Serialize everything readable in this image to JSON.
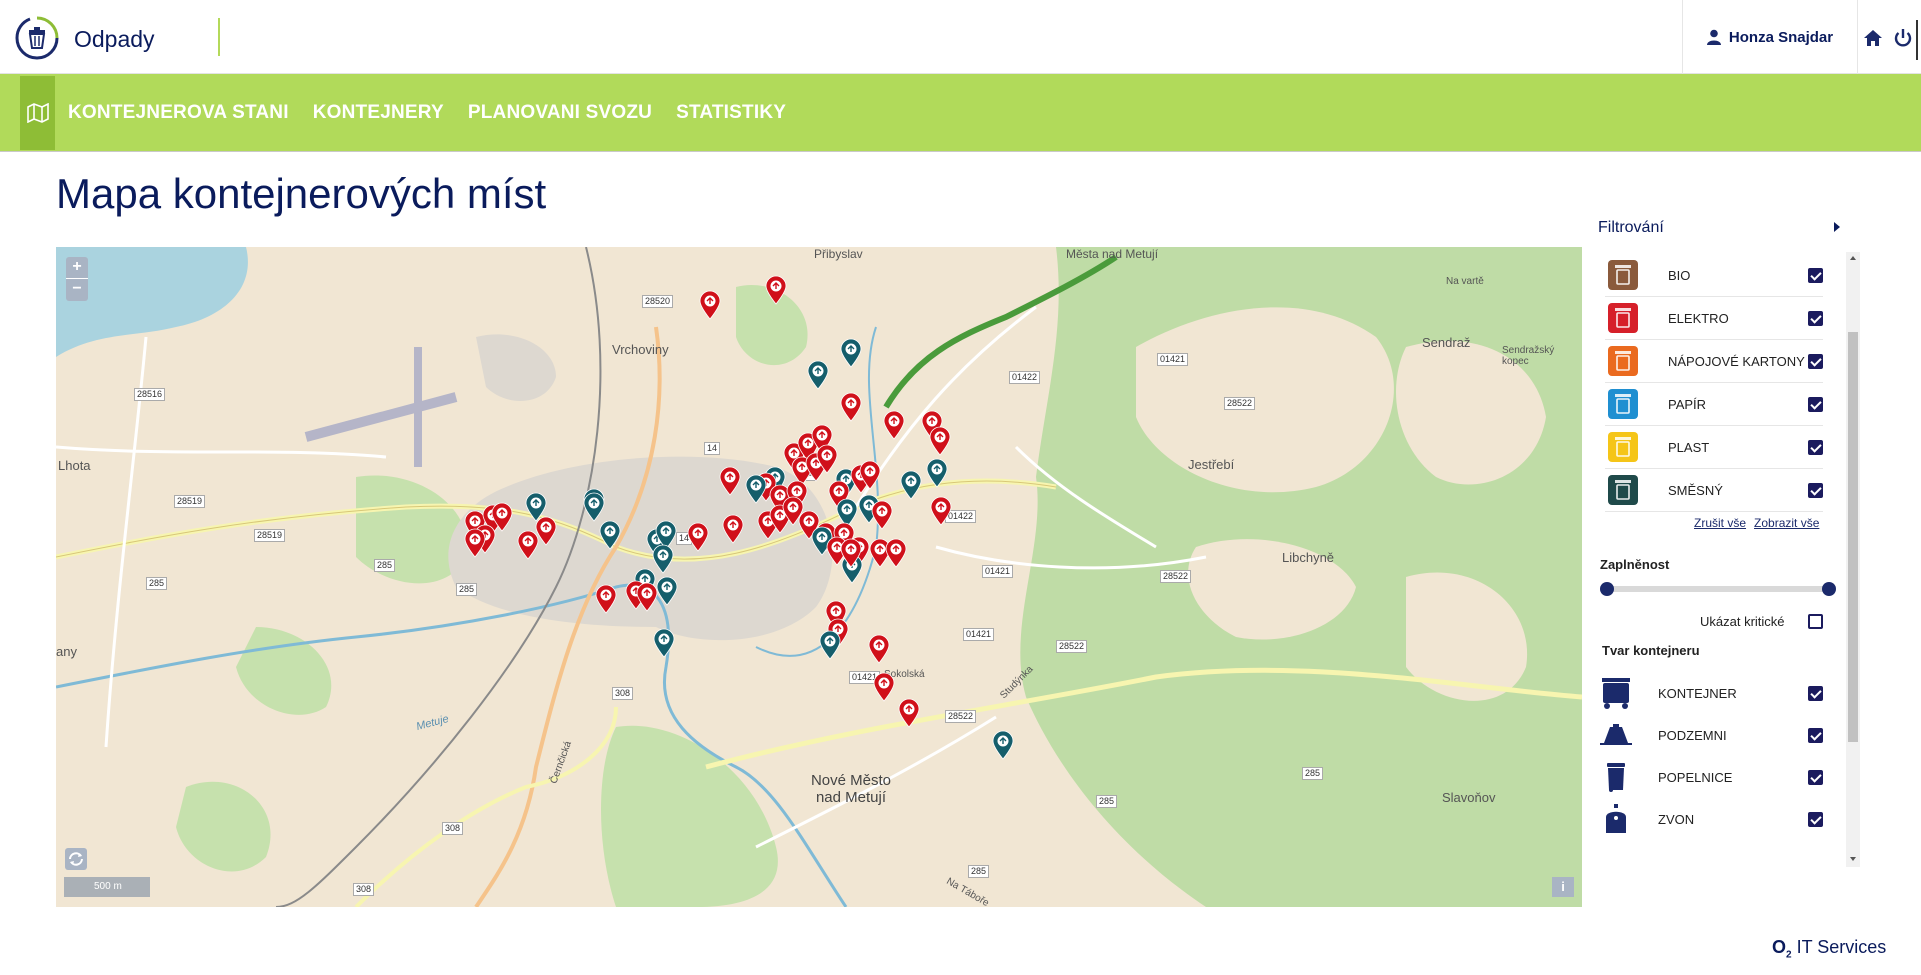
{
  "header": {
    "app_name": "Odpady",
    "user_name": "Honza Snajdar"
  },
  "nav": {
    "items": [
      {
        "label": "KONTEJNEROVA STANI"
      },
      {
        "label": "KONTEJNERY"
      },
      {
        "label": "PLANOVANI SVOZU"
      },
      {
        "label": "STATISTIKY"
      }
    ]
  },
  "page": {
    "title": "Mapa kontejnerových míst"
  },
  "map": {
    "zoom_in": "+",
    "zoom_out": "−",
    "scale_label": "500 m",
    "info_label": "i",
    "place_labels": {
      "vrchoviny": "Vrchoviny",
      "pribyslav": "Přibyslav",
      "mesta_nad_metuji": "Města nad Metují",
      "na_varte": "Na vartě",
      "sendraz": "Sendraž",
      "sendrazsky_kopec": "Sendražský kopec",
      "lhota": "Lhota",
      "jestrebi": "Jestřebí",
      "libchyne": "Libchyně",
      "nove_mesto": "Nové Město nad Metují",
      "slavonov": "Slavoňov",
      "any": "any",
      "na_tabore": "Na Táboře",
      "studynka": "Studýnka",
      "sokolska": "Sokolská",
      "metuje": "Metuje",
      "cernovska": "Černčická"
    },
    "road_numbers": {
      "r28520": "28520",
      "r28516": "28516",
      "r28519a": "28519",
      "r28519b": "28519",
      "r285a": "285",
      "r285b": "285",
      "r285c": "285",
      "r285d": "285",
      "r285e": "285",
      "r285f": "285",
      "r14a": "14",
      "r14b": "14",
      "r14c": "14",
      "r01422a": "01422",
      "r01422b": "01422",
      "r01421a": "01421",
      "r01421b": "01421",
      "r01421c": "01421",
      "r01421d": "01421",
      "r28522a": "28522",
      "r28522b": "28522",
      "r28522c": "28522",
      "r28522d": "28522",
      "r308a": "308",
      "r308b": "308",
      "r308c": "308"
    }
  },
  "filter": {
    "title": "Filtrování",
    "waste_types": [
      {
        "label": "BIO",
        "icon": "bio-bin-icon",
        "color": "#8a5a3c",
        "checked": true
      },
      {
        "label": "ELEKTRO",
        "icon": "elektro-bin-icon",
        "color": "#d6202a",
        "checked": true
      },
      {
        "label": "NÁPOJOVÉ KARTONY",
        "icon": "cartons-bin-icon",
        "color": "#ea6a1f",
        "checked": true
      },
      {
        "label": "PAPÍR",
        "icon": "paper-bin-icon",
        "color": "#1f8fd1",
        "checked": true
      },
      {
        "label": "PLAST",
        "icon": "plastic-bin-icon",
        "color": "#f5c518",
        "checked": true
      },
      {
        "label": "SMĚSNÝ",
        "icon": "mixed-bin-icon",
        "color": "#1f4a4a",
        "checked": true
      }
    ],
    "cancel_all": "Zrušit vše",
    "show_all": "Zobrazit vše",
    "fullness_label": "Zaplněnost",
    "fullness_range": [
      0,
      100
    ],
    "show_critical_label": "Ukázat kritické",
    "show_critical": false,
    "shape_label": "Tvar kontejneru",
    "shapes": [
      {
        "label": "KONTEJNER",
        "icon": "container-icon",
        "checked": true
      },
      {
        "label": "PODZEMNI",
        "icon": "underground-icon",
        "checked": true
      },
      {
        "label": "POPELNICE",
        "icon": "bin-icon",
        "checked": true
      },
      {
        "label": "ZVON",
        "icon": "bell-icon",
        "checked": true
      }
    ]
  },
  "footer": {
    "brand_o2": "O",
    "brand_sub": "2",
    "brand_name": "IT Services"
  },
  "colors": {
    "nav_green": "#b1da5a",
    "pin_red": "#d0101a",
    "pin_teal": "#155e6b",
    "brand_navy": "#0a1b5c"
  }
}
